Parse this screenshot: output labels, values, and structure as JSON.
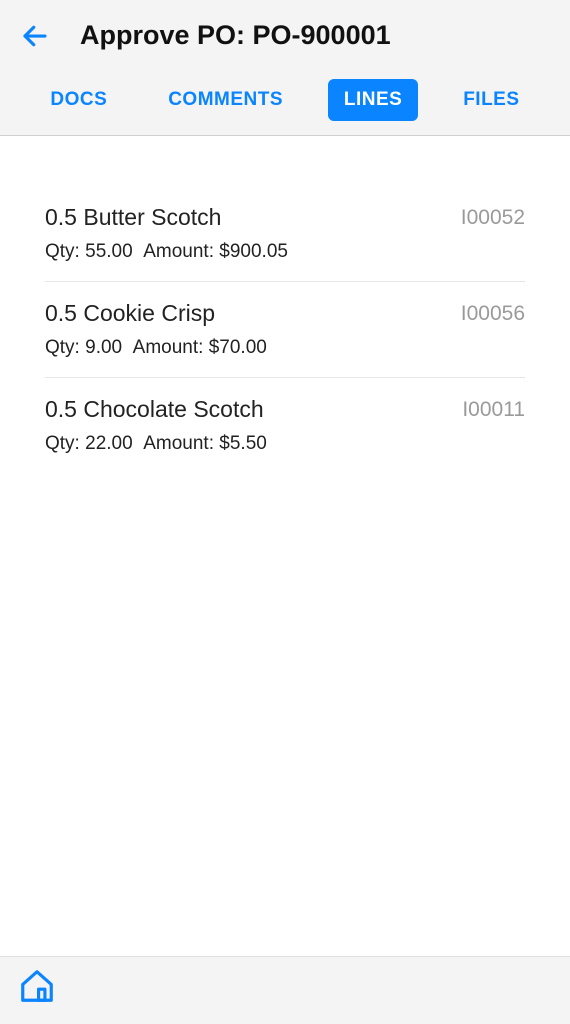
{
  "header": {
    "title": "Approve PO: PO-900001"
  },
  "tabs": [
    {
      "label": "DOCS",
      "active": false
    },
    {
      "label": "COMMENTS",
      "active": false
    },
    {
      "label": "LINES",
      "active": true
    },
    {
      "label": "FILES",
      "active": false
    }
  ],
  "lines": [
    {
      "title": "0.5 Butter Scotch",
      "code": "I00052",
      "qty": "55.00",
      "amount": "$900.05"
    },
    {
      "title": "0.5 Cookie Crisp",
      "code": "I00056",
      "qty": "9.00",
      "amount": "$70.00"
    },
    {
      "title": "0.5 Chocolate Scotch",
      "code": "I00011",
      "qty": "22.00",
      "amount": "$5.50"
    }
  ],
  "labels": {
    "qty": "Qty: ",
    "amount": "Amount: "
  }
}
